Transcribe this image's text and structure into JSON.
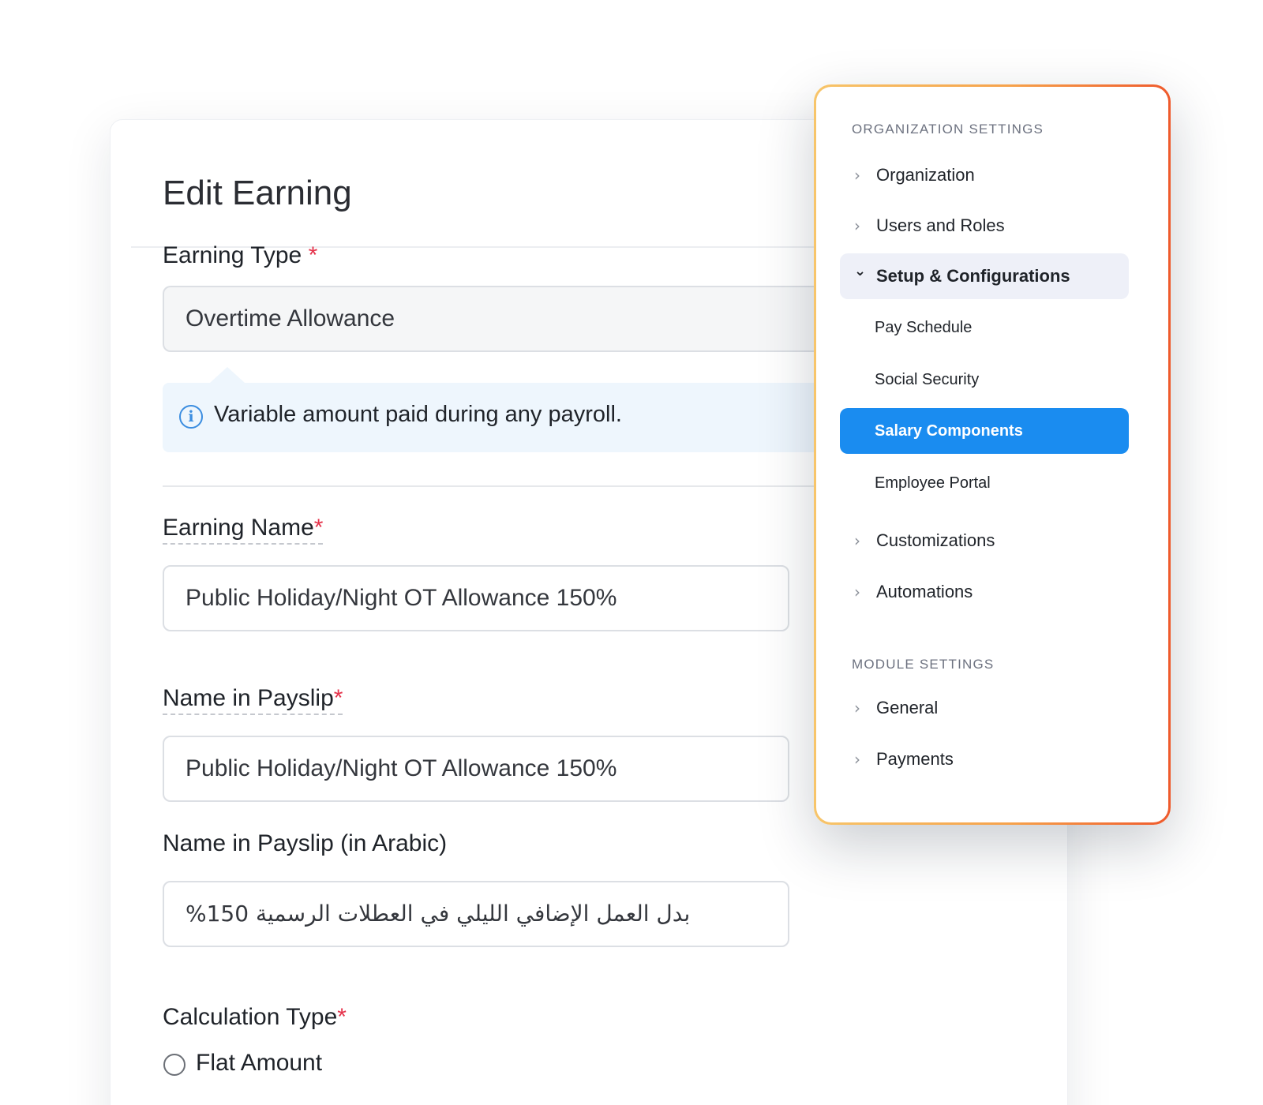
{
  "form": {
    "title": "Edit Earning",
    "earning_type": {
      "label": "Earning Type",
      "required_mark": "*",
      "value": "Overtime Allowance"
    },
    "info": {
      "icon": "info-icon",
      "glyph": "i",
      "text": "Variable amount paid during any payroll."
    },
    "earning_name": {
      "label": "Earning Name",
      "required_mark": "*",
      "value": "Public Holiday/Night OT Allowance 150%"
    },
    "payslip_name": {
      "label": "Name in Payslip",
      "required_mark": "*",
      "value": "Public Holiday/Night OT Allowance 150%"
    },
    "payslip_name_arabic": {
      "label": "Name in Payslip (in Arabic)",
      "value": "%بدل العمل الإضافي الليلي في العطلات الرسمية 150"
    },
    "calculation_type": {
      "label": "Calculation Type",
      "required_mark": "*",
      "option_flat": "Flat Amount"
    }
  },
  "menu": {
    "org_section": "ORGANIZATION SETTINGS",
    "module_section": "MODULE SETTINGS",
    "chevron_right": "›",
    "chevron_down": "⌄",
    "items": {
      "organization": "Organization",
      "users_roles": "Users and Roles",
      "setup": "Setup & Configurations",
      "pay_schedule": "Pay Schedule",
      "social_security": "Social Security",
      "salary_components": "Salary Components",
      "employee_portal": "Employee Portal",
      "customizations": "Customizations",
      "automations": "Automations",
      "general": "General",
      "payments": "Payments"
    }
  },
  "colors": {
    "accent": "#1a8cf0",
    "required": "#e5334b",
    "info_bg": "#eef6fd",
    "panel_border_start": "#f7c56a",
    "panel_border_end": "#ef5a2c"
  }
}
